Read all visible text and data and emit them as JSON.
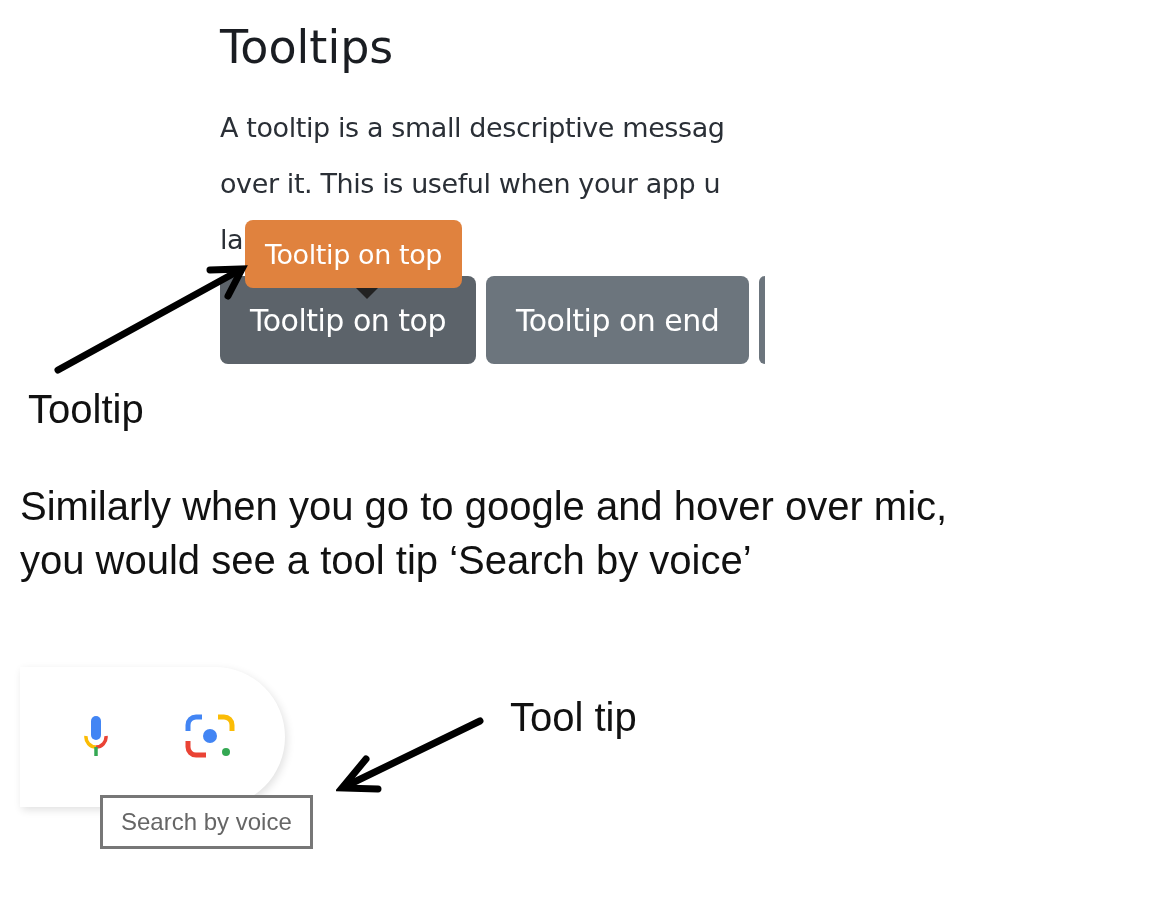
{
  "doc_section": {
    "title": "Tooltips",
    "paragraph_lines": [
      "A tooltip is a small descriptive messag",
      "over it. This is useful when your app u",
      "la"
    ],
    "tooltip": "Tooltip on top",
    "buttons": [
      {
        "label": "Tooltip on top",
        "hovered": true
      },
      {
        "label": "Tooltip on end",
        "hovered": false
      }
    ]
  },
  "annotation_1": "Tooltip",
  "explanation": "Similarly when you go to google and hover over mic,\nyou would see a tool tip ‘Search by voice’",
  "search_bar": {
    "tooltip": "Search by voice"
  },
  "annotation_2": "Tool tip"
}
